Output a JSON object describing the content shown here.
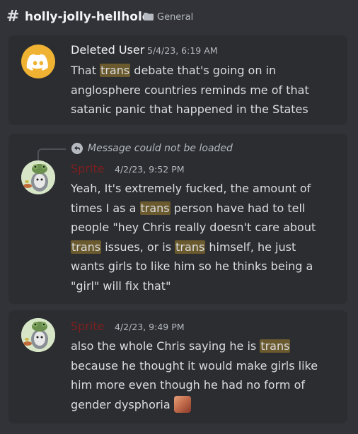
{
  "channel": {
    "hash": "#",
    "name": "holly-jolly-hellhole",
    "category": "General",
    "folder_icon": "folder-icon"
  },
  "messages": [
    {
      "username": "Deleted User",
      "username_color": "#f2f3f5",
      "timestamp": "5/4/23, 6:19 AM",
      "avatar": "discord-logo-avatar",
      "avatar_color": "#f0b232",
      "lines": [
        [
          "That ",
          {
            "hl": "trans"
          },
          " debate that's going on in"
        ],
        [
          "anglosphere countries reminds me of that"
        ],
        [
          "satanic panic that happened in the States"
        ]
      ]
    },
    {
      "reply_icon": "reply-arrow-icon",
      "reply_text": "Message could not be loaded",
      "username": "Sprite",
      "username_color": "#7d1f1f",
      "timestamp": "4/2/23, 9:52 PM",
      "avatar": "frog-character-avatar",
      "lines": [
        [
          "Yeah, It's extremely fucked, the amount of"
        ],
        [
          "times I as a ",
          {
            "hl": "trans"
          },
          " person have had to tell"
        ],
        [
          "people \"hey Chris really doesn't care about"
        ],
        [
          {
            "hl": "trans"
          },
          " issues, or is ",
          {
            "hl": "trans"
          },
          " himself, he just"
        ],
        [
          "wants girls to like him so he thinks being a"
        ],
        [
          "\"girl\" will fix that\""
        ]
      ]
    },
    {
      "username": "Sprite",
      "username_color": "#7d1f1f",
      "timestamp": "4/2/23, 9:49 PM",
      "avatar": "frog-character-avatar",
      "lines": [
        [
          "also the whole Chris saying he is ",
          {
            "hl": "trans"
          }
        ],
        [
          "because he thought it would make girls like"
        ],
        [
          "him more even though he had no form of"
        ],
        [
          "gender dysphoria ",
          {
            "emoji": "hand-emoji"
          }
        ]
      ]
    }
  ]
}
